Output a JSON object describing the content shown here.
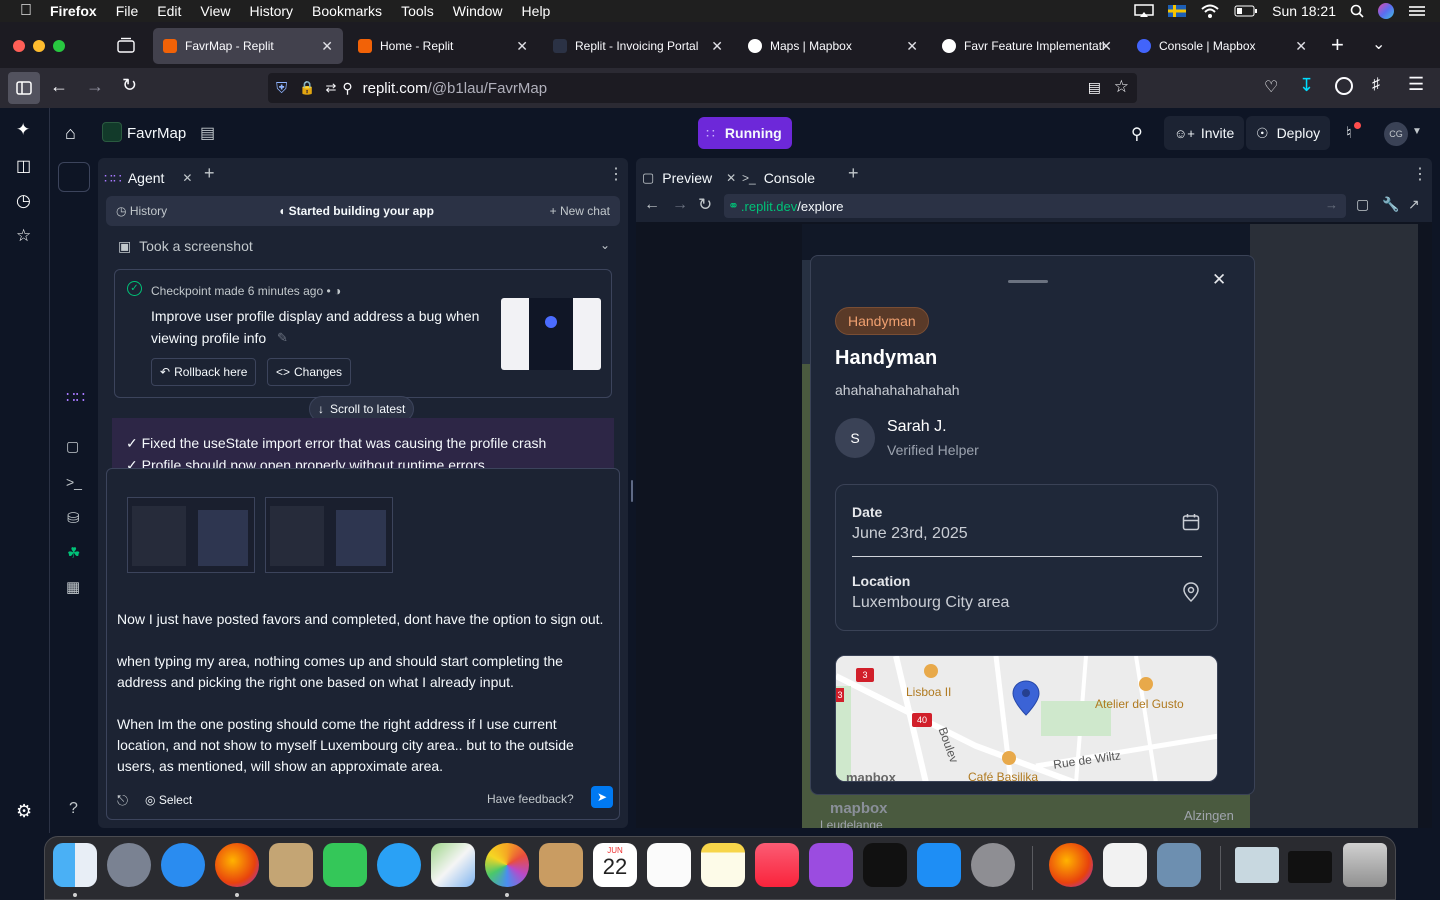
{
  "menubar": {
    "items": [
      "Firefox",
      "File",
      "Edit",
      "View",
      "History",
      "Bookmarks",
      "Tools",
      "Window",
      "Help"
    ],
    "clock": "Sun 18:21"
  },
  "browser": {
    "tabs": [
      {
        "label": "FavrMap - Replit",
        "active": true
      },
      {
        "label": "Home - Replit"
      },
      {
        "label": "Replit - Invoicing Portal"
      },
      {
        "label": "Maps | Mapbox"
      },
      {
        "label": "Favr Feature Implementati"
      },
      {
        "label": "Console | Mapbox"
      }
    ],
    "url_domain": "replit.com",
    "url_path": "/@b1lau/FavrMap"
  },
  "replit": {
    "project_name": "FavrMap",
    "run_status": "Running",
    "invite_label": "Invite",
    "deploy_label": "Deploy",
    "avatar_initials": "CG",
    "agent_tab": "Agent",
    "history_label": "History",
    "chat_status": "Started building your app",
    "new_chat_label": "New chat",
    "screenshot_label": "Took a screenshot",
    "checkpoint": {
      "label": "Checkpoint made",
      "time": "6 minutes ago",
      "text_line1": "Improve user profile display and address a bug when",
      "text_line2": "viewing profile info",
      "rollback_label": "Rollback here",
      "changes_label": "Changes"
    },
    "scroll_latest": "Scroll to latest",
    "agent_messages": [
      "✓ Fixed the useState import error that was causing the profile crash",
      "✓ Profile should now open properly without runtime errors"
    ],
    "user_message": [
      "Now I just have posted favors and completed, dont have the option to sign out.",
      "when typing my area, nothing comes up and should start completing the",
      "address and picking the right one based on what I already input.",
      "When Im the one posting should come the right address if I use current",
      "location, and not show to myself Luxembourg city area.. but to the outside",
      "users, as mentioned, will show an approximate area."
    ],
    "select_label": "Select",
    "feedback_label": "Have feedback?",
    "preview_tab": "Preview",
    "console_tab": "Console",
    "preview_url_domain": ".replit.dev",
    "preview_url_path": "/explore"
  },
  "modal": {
    "badge": "Handyman",
    "title": "Handyman",
    "description": "ahahahahahahahah",
    "helper_initial": "S",
    "helper_name": "Sarah J.",
    "helper_status": "Verified Helper",
    "date_label": "Date",
    "date_value": "June 23rd, 2025",
    "location_label": "Location",
    "location_value": "Luxembourg City area",
    "map_labels": [
      "Lisboa II",
      "Atelier del Gusto",
      "Rue de Wiltz",
      "Café Basilika",
      "Boulev",
      "3",
      "3",
      "40"
    ],
    "map_attribution": "mapbox"
  },
  "bg_map": {
    "attribution": "mapbox",
    "labels": [
      "Alzingen",
      "Leudelange"
    ]
  },
  "dock": {
    "calendar_month": "JUN",
    "calendar_day": "22"
  },
  "colors": {
    "replit_bg": "#0e1525",
    "panel": "#1c2333",
    "accent_purple": "#7c3aed",
    "badge": "#5a3a28",
    "badge_text": "#f0a070"
  }
}
